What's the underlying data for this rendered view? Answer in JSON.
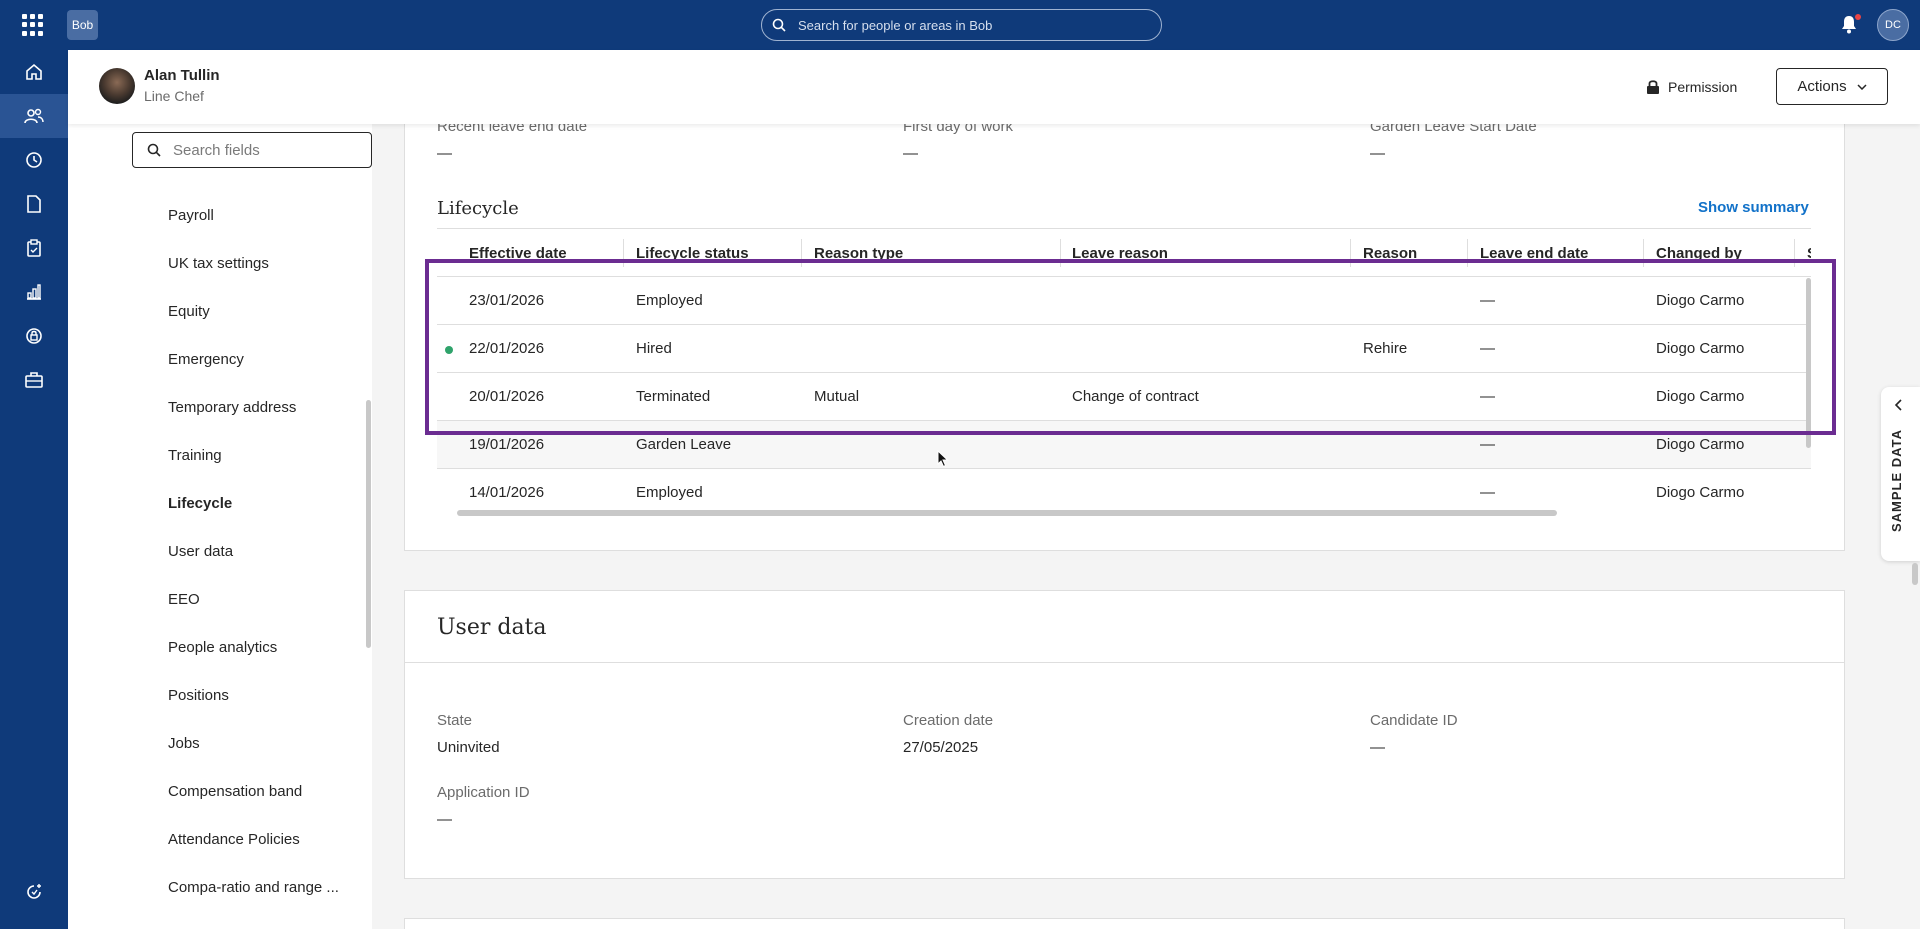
{
  "topbar": {
    "logo": "Bob",
    "search_placeholder": "Search for people or areas in Bob",
    "user_initials": "DC"
  },
  "rail": {
    "icons": [
      "home-icon",
      "people-icon",
      "clock-icon",
      "document-icon",
      "clipboard-icon",
      "analytics-icon",
      "shield-icon",
      "briefcase-icon",
      "whats-new-icon"
    ],
    "active": "people-icon"
  },
  "profile": {
    "name": "Alan Tullin",
    "title": "Line Chef",
    "permission_label": "Permission",
    "actions_label": "Actions"
  },
  "fields_nav": {
    "search_placeholder": "Search fields",
    "items": [
      {
        "label": "Payroll"
      },
      {
        "label": "UK tax settings"
      },
      {
        "label": "Equity"
      },
      {
        "label": "Emergency"
      },
      {
        "label": "Temporary address"
      },
      {
        "label": "Training"
      },
      {
        "label": "Lifecycle"
      },
      {
        "label": "User data"
      },
      {
        "label": "EEO"
      },
      {
        "label": "People analytics"
      },
      {
        "label": "Positions"
      },
      {
        "label": "Jobs"
      },
      {
        "label": "Compensation band"
      },
      {
        "label": "Attendance Policies"
      },
      {
        "label": "Compa-ratio and range ..."
      }
    ],
    "active": "Lifecycle"
  },
  "top_fields": [
    {
      "label": "Recent leave end date",
      "value": "—"
    },
    {
      "label": "First day of work",
      "value": "—"
    },
    {
      "label": "Garden Leave Start Date",
      "value": "—"
    }
  ],
  "lifecycle": {
    "title": "Lifecycle",
    "show_summary": "Show summary",
    "columns": [
      "Effective date",
      "Lifecycle status",
      "Reason type",
      "Leave reason",
      "Reason",
      "Leave end date",
      "Changed by",
      "S"
    ],
    "rows": [
      {
        "date": "23/01/2026",
        "status": "Employed",
        "reason_type": "",
        "leave_reason": "",
        "reason": "",
        "leave_end": "—",
        "changed_by": "Diogo Carmo",
        "active": false
      },
      {
        "date": "22/01/2026",
        "status": "Hired",
        "reason_type": "",
        "leave_reason": "",
        "reason": "Rehire",
        "leave_end": "—",
        "changed_by": "Diogo Carmo",
        "active": true
      },
      {
        "date": "20/01/2026",
        "status": "Terminated",
        "reason_type": "Mutual",
        "leave_reason": "Change of contract",
        "reason": "",
        "leave_end": "—",
        "changed_by": "Diogo Carmo",
        "active": false
      },
      {
        "date": "19/01/2026",
        "status": "Garden Leave",
        "reason_type": "",
        "leave_reason": "",
        "reason": "",
        "leave_end": "—",
        "changed_by": "Diogo Carmo",
        "active": false
      },
      {
        "date": "14/01/2026",
        "status": "Employed",
        "reason_type": "",
        "leave_reason": "",
        "reason": "",
        "leave_end": "—",
        "changed_by": "Diogo Carmo",
        "active": false
      }
    ]
  },
  "user_data": {
    "title": "User data",
    "fields": [
      {
        "label": "State",
        "value": "Uninvited"
      },
      {
        "label": "Creation date",
        "value": "27/05/2025"
      },
      {
        "label": "Candidate ID",
        "value": "—"
      },
      {
        "label": "Application ID",
        "value": "—"
      }
    ]
  },
  "sample_data_tab": "SAMPLE DATA",
  "colors": {
    "topbar": "#0f3a7a",
    "accent_link": "#1272c9",
    "highlight_border": "#6b2c91",
    "active_dot": "#2fa36b"
  }
}
